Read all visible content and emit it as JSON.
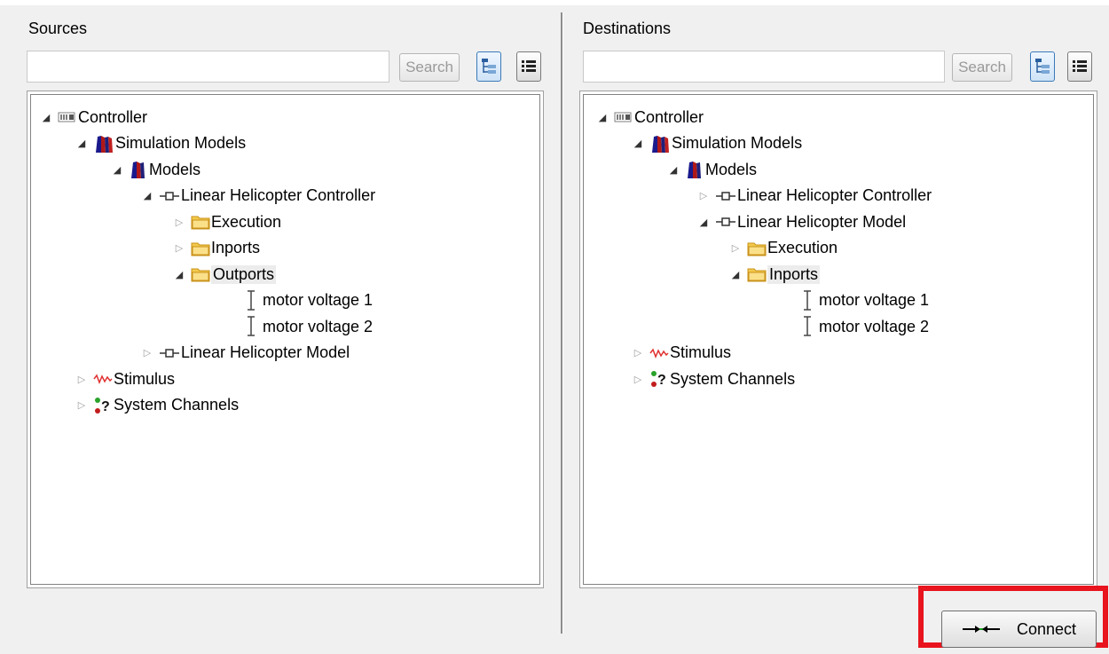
{
  "sources": {
    "title": "Sources",
    "search_value": "",
    "search_button": "Search",
    "tree": [
      {
        "label": "Controller",
        "icon": "controller-icon",
        "expander": "expanded"
      },
      {
        "label": "Simulation Models",
        "icon": "simulation-models-icon",
        "expander": "expanded"
      },
      {
        "label": "Models",
        "icon": "models-icon",
        "expander": "expanded"
      },
      {
        "label": "Linear Helicopter Controller",
        "icon": "block-icon",
        "expander": "expanded"
      },
      {
        "label": "Execution",
        "icon": "folder-icon",
        "expander": "collapsed"
      },
      {
        "label": "Inports",
        "icon": "folder-icon",
        "expander": "collapsed"
      },
      {
        "label": "Outports",
        "icon": "folder-icon",
        "expander": "expanded",
        "selected": true
      },
      {
        "label": "motor voltage 1",
        "icon": "signal-icon",
        "expander": "none"
      },
      {
        "label": "motor voltage 2",
        "icon": "signal-icon",
        "expander": "none"
      },
      {
        "label": "Linear Helicopter Model",
        "icon": "block-icon",
        "expander": "collapsed"
      },
      {
        "label": "Stimulus",
        "icon": "stimulus-icon",
        "expander": "collapsed"
      },
      {
        "label": "System Channels",
        "icon": "system-channels-icon",
        "expander": "collapsed"
      }
    ]
  },
  "destinations": {
    "title": "Destinations",
    "search_value": "",
    "search_button": "Search",
    "tree": [
      {
        "label": "Controller",
        "icon": "controller-icon",
        "expander": "expanded"
      },
      {
        "label": "Simulation Models",
        "icon": "simulation-models-icon",
        "expander": "expanded"
      },
      {
        "label": "Models",
        "icon": "models-icon",
        "expander": "expanded"
      },
      {
        "label": "Linear Helicopter Controller",
        "icon": "block-icon",
        "expander": "collapsed"
      },
      {
        "label": "Linear Helicopter Model",
        "icon": "block-icon",
        "expander": "expanded"
      },
      {
        "label": "Execution",
        "icon": "folder-icon",
        "expander": "collapsed"
      },
      {
        "label": "Inports",
        "icon": "folder-icon",
        "expander": "expanded",
        "selected": true
      },
      {
        "label": "motor voltage 1",
        "icon": "signal-icon",
        "expander": "none"
      },
      {
        "label": "motor voltage 2",
        "icon": "signal-icon",
        "expander": "none"
      },
      {
        "label": "Stimulus",
        "icon": "stimulus-icon",
        "expander": "collapsed"
      },
      {
        "label": "System Channels",
        "icon": "system-channels-icon",
        "expander": "collapsed"
      }
    ]
  },
  "connect_button": {
    "label": "Connect",
    "icon": "connect-arrows-icon"
  },
  "colors": {
    "highlight_border": "#e8141e",
    "folder": "#f2c94c",
    "selection": "#ececec"
  }
}
